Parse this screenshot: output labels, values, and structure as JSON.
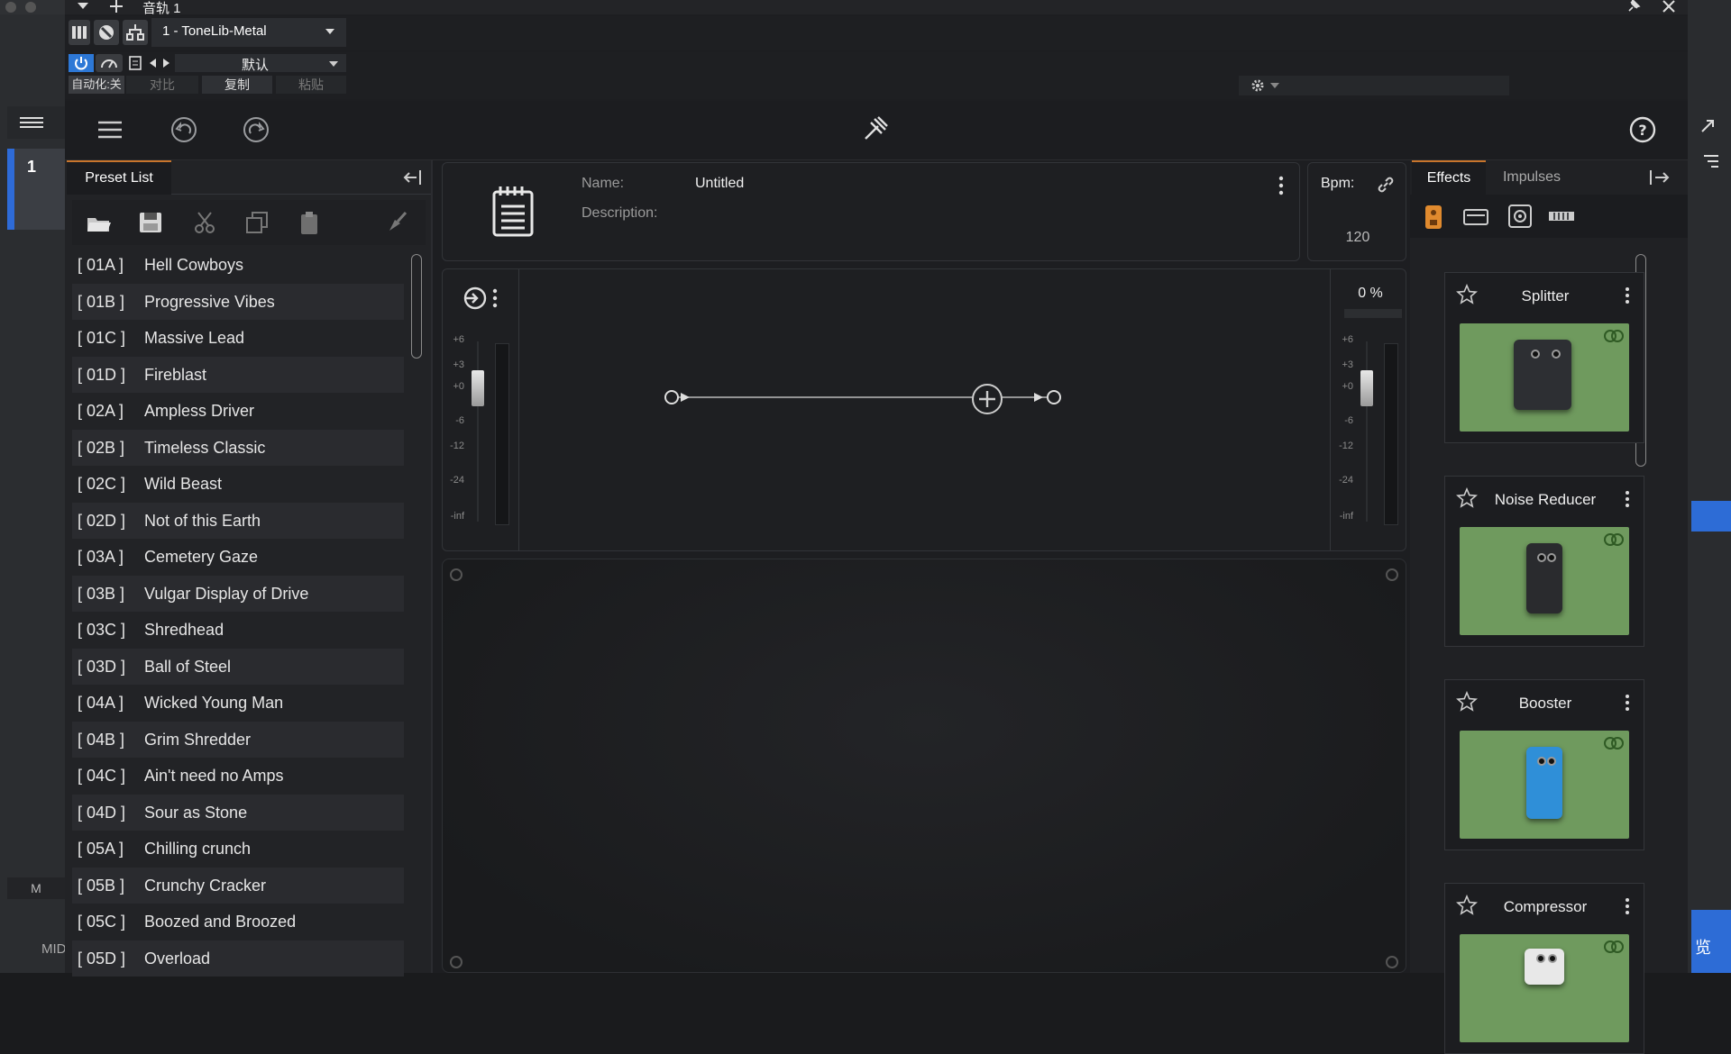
{
  "host": {
    "window_title": "音轨 1",
    "track_number": "1",
    "mute_label": "M",
    "midi_label": "MID",
    "right_button_label": "览"
  },
  "daw_plugin_bar": {
    "preset_selector": "1 - ToneLib-Metal",
    "program_selector": "默认",
    "automation_label": "自动化:关",
    "compare_label": "对比",
    "copy_label": "复制",
    "paste_label": "粘贴"
  },
  "preset_panel": {
    "tab_label": "Preset List",
    "presets": [
      {
        "code": "[ 01A ]",
        "name": "Hell Cowboys"
      },
      {
        "code": "[ 01B ]",
        "name": "Progressive Vibes"
      },
      {
        "code": "[ 01C ]",
        "name": "Massive Lead"
      },
      {
        "code": "[ 01D ]",
        "name": "Fireblast"
      },
      {
        "code": "[ 02A ]",
        "name": "Ampless Driver"
      },
      {
        "code": "[ 02B ]",
        "name": "Timeless Classic"
      },
      {
        "code": "[ 02C ]",
        "name": "Wild Beast"
      },
      {
        "code": "[ 02D ]",
        "name": "Not of this Earth"
      },
      {
        "code": "[ 03A ]",
        "name": "Cemetery Gaze"
      },
      {
        "code": "[ 03B ]",
        "name": "Vulgar Display of Drive"
      },
      {
        "code": "[ 03C ]",
        "name": "Shredhead"
      },
      {
        "code": "[ 03D ]",
        "name": "Ball of Steel"
      },
      {
        "code": "[ 04A ]",
        "name": "Wicked Young Man"
      },
      {
        "code": "[ 04B ]",
        "name": "Grim Shredder"
      },
      {
        "code": "[ 04C ]",
        "name": "Ain't need no Amps"
      },
      {
        "code": "[ 04D ]",
        "name": "Sour as Stone"
      },
      {
        "code": "[ 05A ]",
        "name": "Chilling crunch"
      },
      {
        "code": "[ 05B ]",
        "name": "Crunchy Cracker"
      },
      {
        "code": "[ 05C ]",
        "name": "Boozed and Broozed"
      },
      {
        "code": "[ 05D ]",
        "name": "Overload"
      }
    ]
  },
  "header": {
    "name_label": "Name:",
    "name_value": "Untitled",
    "description_label": "Description:",
    "description_value": "",
    "bpm_label": "Bpm:",
    "bpm_value": "120"
  },
  "signal_chain": {
    "output_percent": "0 %",
    "meter_scale": [
      "+6",
      "+3",
      "+0",
      "-6",
      "-12",
      "-24",
      "-inf"
    ],
    "input_level_db": 0,
    "output_level_db": 0
  },
  "effects_panel": {
    "tabs": [
      "Effects",
      "Impulses"
    ],
    "active_tab": "Effects",
    "effects": [
      {
        "name": "Splitter",
        "pedal_color": "#2d2f33",
        "label": "SPLITTER"
      },
      {
        "name": "Noise Reducer",
        "pedal_color": "#2a2b2e",
        "label": "NOISE"
      },
      {
        "name": "Booster",
        "pedal_color": "#2f8fd8",
        "label": "BOOSTER"
      },
      {
        "name": "Compressor",
        "pedal_color": "#e8e8e8",
        "label": ""
      }
    ]
  },
  "colors": {
    "accent_orange": "#c8752c",
    "power_blue": "#2d78d6",
    "fx_card_green": "#6f9a5e",
    "track_blue": "#2e6bd8"
  }
}
